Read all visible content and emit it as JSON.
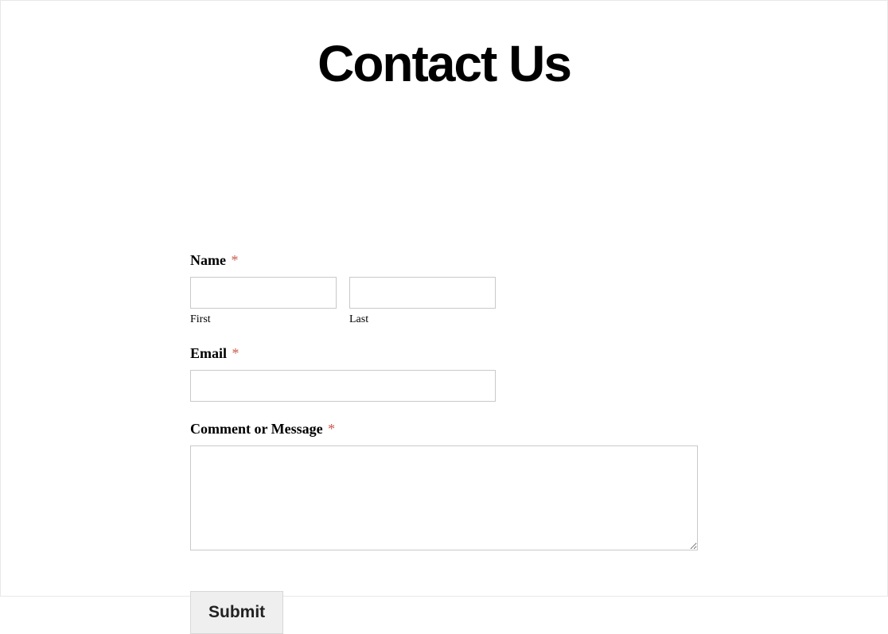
{
  "title": "Contact Us",
  "form": {
    "name": {
      "label": "Name",
      "required_marker": "*",
      "first_sublabel": "First",
      "last_sublabel": "Last",
      "first_value": "",
      "last_value": ""
    },
    "email": {
      "label": "Email",
      "required_marker": "*",
      "value": ""
    },
    "message": {
      "label": "Comment or Message",
      "required_marker": "*",
      "value": ""
    },
    "submit_label": "Submit"
  }
}
